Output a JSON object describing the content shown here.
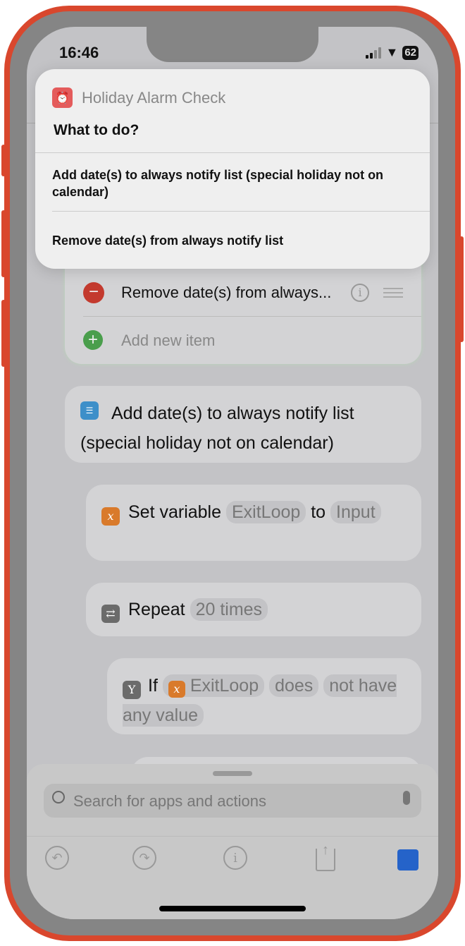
{
  "status": {
    "time": "16:46",
    "battery": "62"
  },
  "popup": {
    "app_name": "Holiday Alarm Check",
    "prompt": "What to do?",
    "options": [
      "Add date(s) to always notify list (special holiday not on calendar)",
      "Remove date(s) from always notify list"
    ]
  },
  "list_card": {
    "row": "Remove date(s) from always...",
    "add_item": "Add new item"
  },
  "case_card": {
    "label": "Add date(s) to always notify list (special holiday not on calendar)"
  },
  "set_variable": {
    "action": "Set variable",
    "variable": "ExitLoop",
    "to": "to",
    "value": "Input"
  },
  "repeat": {
    "action": "Repeat",
    "count": "20 times"
  },
  "if_block": {
    "action": "If",
    "variable": "ExitLoop",
    "condition_a": "does",
    "condition_b": "not have any value"
  },
  "search": {
    "placeholder": "Search for apps and actions"
  },
  "colors": {
    "frame": "#d9472d",
    "accent": "#2563c9",
    "app_icon": "#e45b5b",
    "variable_icon": "#d97a2b"
  }
}
